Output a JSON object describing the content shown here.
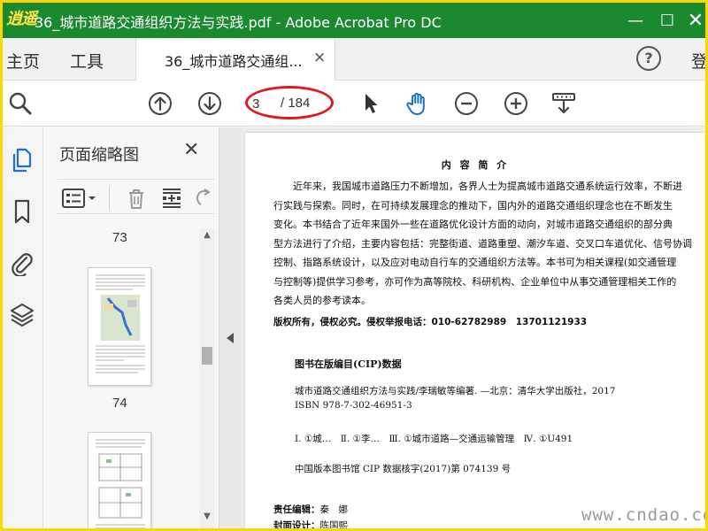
{
  "window": {
    "logo_text": "逍遥",
    "title": "36_城市道路交通组织方法与实践.pdf - Adobe Acrobat Pro DC",
    "minimize": "—",
    "maximize": "☐",
    "close": "✕"
  },
  "tabs": {
    "home": "主页",
    "tools": "工具",
    "document": "36_城市道路交通组...",
    "document_close": "×",
    "help": "?",
    "signin": "登"
  },
  "toolbar": {
    "page_current": "3",
    "page_total": "/ 184",
    "annotation_color": "#e0191f"
  },
  "thumbnail_panel": {
    "title": "页面缩略图",
    "close": "✕",
    "page_labels": [
      "73",
      "74"
    ]
  },
  "document": {
    "heading": "内 容 简 介",
    "paragraph_lines": [
      "　　近年来，我国城市道路压力不断增加，各界人士为提高城市道路交通系统运行效率，不断进",
      "行实践与探索。同时，在可持续发展理念的推动下，国内外的道路交通组织理念也在不断发生",
      "变化。本书结合了近年来国外一些在道路优化设计方面的动向，对城市道路交通组织的部分典",
      "型方法进行了介绍，主要内容包括：完整街道、道路重塑、潮汐车道、交叉口车道优化、信号协调",
      "控制、指路系统设计，以及应对电动自行车的交通组织方法等。本书可为相关课程(如交通管理",
      "与控制等)提供学习参考，亦可作为高等院校、科研机构、企业单位中从事交通管理相关工作的",
      "各类人员的参考读本。"
    ],
    "copyright": "版权所有，侵权必究。侵权举报电话：010-62782989　13701121933",
    "cip_title": "图书在版编目(CIP)数据",
    "cip_line1": "城市道路交通组织方法与实践/李瑞敏等编著. —北京：清华大学出版社，2017",
    "cip_line2": "ISBN 978-7-302-46951-3",
    "cip_line3": "Ⅰ. ①城…　Ⅱ. ①李…　Ⅲ. ①城市道路—交通运输管理　Ⅳ. ①U491",
    "cip_line4": "中国版本图书馆 CIP 数据核字(2017)第 074139 号",
    "editor_label": "责任编辑：",
    "editor_value": "秦　娜",
    "cover_label": "封面设计：",
    "cover_value": "陈国熙"
  },
  "watermark": "www.cndao.com"
}
